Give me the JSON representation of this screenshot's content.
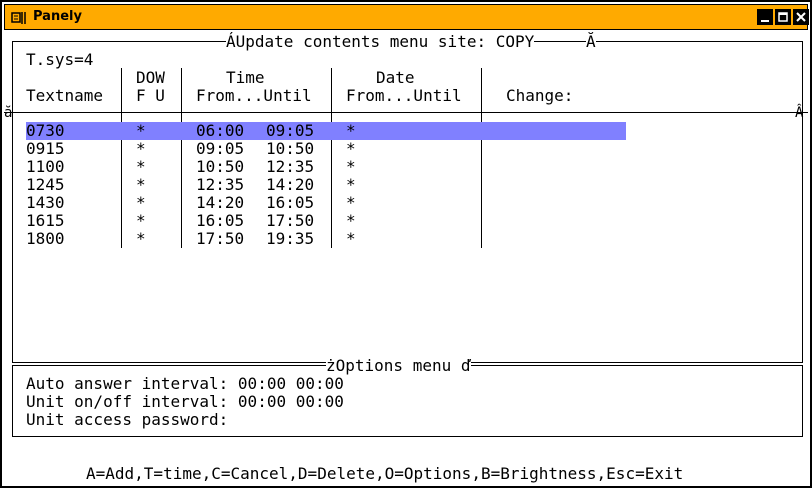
{
  "window": {
    "title": "Panely"
  },
  "editor": {
    "frame_title_left": "ÁUpdate contents menu site: COPY",
    "frame_title_right": "Ă",
    "tsys": "T.sys=4",
    "side_marker_left": "ă",
    "side_marker_right": "Â",
    "headers": {
      "dow_top": "DOW",
      "time_top": "Time",
      "date_top": "Date",
      "textname": "Textname",
      "dow_bottom": "F U",
      "time_bottom": "From...Until",
      "date_bottom": "From...Until",
      "change": "Change:"
    },
    "rows": [
      {
        "name": "0730",
        "dow": "*",
        "from": "06:00",
        "until": "09:05",
        "date": "*",
        "change": ""
      },
      {
        "name": "0915",
        "dow": "*",
        "from": "09:05",
        "until": "10:50",
        "date": "*",
        "change": ""
      },
      {
        "name": "1100",
        "dow": "*",
        "from": "10:50",
        "until": "12:35",
        "date": "*",
        "change": ""
      },
      {
        "name": "1245",
        "dow": "*",
        "from": "12:35",
        "until": "14:20",
        "date": "*",
        "change": ""
      },
      {
        "name": "1430",
        "dow": "*",
        "from": "14:20",
        "until": "16:05",
        "date": "*",
        "change": ""
      },
      {
        "name": "1615",
        "dow": "*",
        "from": "16:05",
        "until": "17:50",
        "date": "*",
        "change": ""
      },
      {
        "name": "1800",
        "dow": "*",
        "from": "17:50",
        "until": "19:35",
        "date": "*",
        "change": ""
      }
    ],
    "selected_row": 0
  },
  "options": {
    "title": "żOptions menu ď",
    "auto_answer": "Auto answer interval: 00:00 00:00",
    "unit_onoff": "Unit on/off interval: 00:00 00:00",
    "unit_password": "Unit access password:"
  },
  "status_bar": "A=Add,T=time,C=Cancel,D=Delete,O=Options,B=Brightness,Esc=Exit",
  "colors": {
    "titlebar": "#ffaa00",
    "selection": "#8080ff"
  }
}
